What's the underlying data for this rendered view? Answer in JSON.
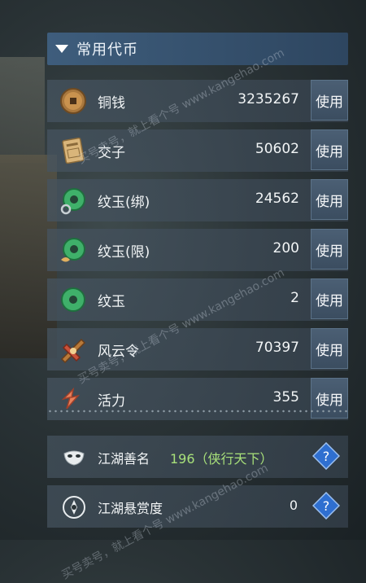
{
  "panel": {
    "title": "常用代币"
  },
  "items": [
    {
      "name": "铜钱",
      "count": "3235267",
      "use": "使用",
      "icon": "copper-coin-icon"
    },
    {
      "name": "交子",
      "count": "50602",
      "use": "使用",
      "icon": "paper-note-icon"
    },
    {
      "name": "纹玉(绑)",
      "count": "24562",
      "use": "使用",
      "icon": "jade-bound-icon"
    },
    {
      "name": "纹玉(限)",
      "count": "200",
      "use": "使用",
      "icon": "jade-limited-icon"
    },
    {
      "name": "纹玉",
      "count": "2",
      "use": "使用",
      "icon": "jade-icon"
    },
    {
      "name": "风云令",
      "count": "70397",
      "use": "使用",
      "icon": "fengyun-token-icon"
    },
    {
      "name": "活力",
      "count": "355",
      "use": "使用",
      "icon": "vitality-icon"
    }
  ],
  "reputation": {
    "name": "江湖善名",
    "value": "196（侠行天下）",
    "icon": "mask-icon"
  },
  "bounty": {
    "name": "江湖悬赏度",
    "value": "0",
    "icon": "bounty-emblem-icon"
  },
  "watermark": "买号卖号，就上看个号 www.kangehao.com",
  "colors": {
    "accent_header": "#3e5d7c",
    "good_value": "#a8e07a",
    "help_blue": "#2f6fd0"
  }
}
